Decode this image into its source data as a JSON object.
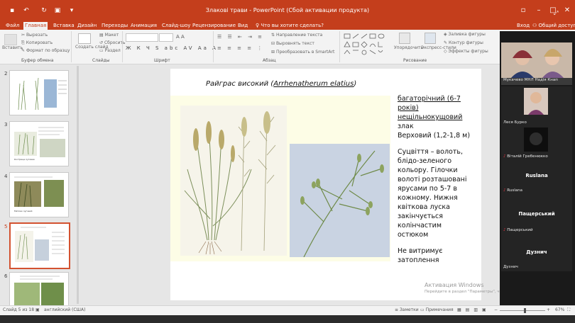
{
  "window": {
    "title": "Злакові трави - PowerPoint (Сбой активации продукта)",
    "signin": "Вход",
    "share": "Общий доступ"
  },
  "tabs": [
    "Файл",
    "Главная",
    "Вставка",
    "Дизайн",
    "Переходы",
    "Анимация",
    "Слайд-шоу",
    "Рецензирование",
    "Вид"
  ],
  "tell_me": "Что вы хотите сделать?",
  "ribbon": {
    "paste": "Вставить",
    "cut": "Вырезать",
    "copy": "Копировать",
    "format_painter": "Формат по образцу",
    "clipboard_group": "Буфер обмена",
    "new_slide": "Создать слайд",
    "layout": "Макет",
    "reset": "Сбросить",
    "section": "Раздел",
    "slides_group": "Слайды",
    "font_group": "Шрифт",
    "paragraph_group": "Абзац",
    "text_direction": "Направление текста",
    "align_text": "Выровнять текст",
    "smartart": "Преобразовать в SmartArt",
    "arrange": "Упорядочить",
    "quick_styles": "Экспресс-стили",
    "drawing_group": "Рисование",
    "shape_fill": "Заливка фигуры",
    "shape_outline": "Контур фигуры",
    "shape_effects": "Эффекты фигуры"
  },
  "thumbnails": [
    {
      "num": "2"
    },
    {
      "num": "3",
      "caption": "Кострица луговая"
    },
    {
      "num": "4",
      "caption": "Мятлик луговой"
    },
    {
      "num": "5"
    },
    {
      "num": "6"
    }
  ],
  "slide": {
    "heading_plain": "Райграс високий (",
    "heading_latin": "Arrhenatherum elatius",
    "heading_close": ")",
    "lines": [
      "багаторічний (6-7",
      "років)",
      "нещільнокущовий",
      "злак",
      "Верховий (1,2-1,8 м)",
      "Суцвіття – волоть,",
      "блідо-зеленого",
      "кольору. Гілочки",
      "волоті розташовані",
      "ярусами по 5-7 в",
      "кожному. Нижня",
      "квіткова луска",
      "закінчується",
      "колінчастим",
      "остюком",
      "Не витримує",
      "затоплення"
    ]
  },
  "zoom": {
    "participants": [
      "Мукачево МНЛ Надія Кнап",
      "Леся Бурко",
      "Віталій Гребенюкко",
      "Ruslana",
      "Ruslana",
      "Пащерський",
      "Пащерський",
      "Дузнич",
      "Дузнич"
    ]
  },
  "watermark": {
    "line1": "Активация Windows",
    "line2": "Перейдите в раздел \"Параметры\", чтобы активировать Windows."
  },
  "status": {
    "slide": "Слайд 5 из 18",
    "lang": "английский (США)",
    "notes": "Заметки",
    "comments": "Примечания",
    "zoom": "67%"
  }
}
